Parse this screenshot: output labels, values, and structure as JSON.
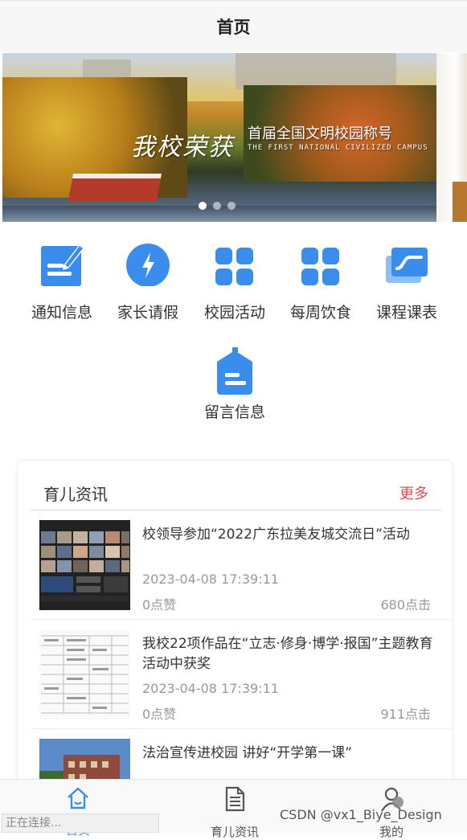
{
  "header": {
    "title": "首页"
  },
  "banner": {
    "slogan_main": "我校荣获",
    "slogan_sub": "首届全国文明校园称号",
    "slogan_en": "THE FIRST NATIONAL CIVILIZED CAMPUS",
    "active_dot": 0,
    "dots_count": 3
  },
  "menu": [
    {
      "label": "通知信息",
      "icon": "edit-note-icon",
      "color": "#3b8ded"
    },
    {
      "label": "家长请假",
      "icon": "lightning-icon",
      "color": "#3b8ded"
    },
    {
      "label": "校园活动",
      "icon": "grid-icon",
      "color": "#3b8ded"
    },
    {
      "label": "每周饮食",
      "icon": "grid-icon",
      "color": "#3b8ded"
    },
    {
      "label": "课程课表",
      "icon": "chart-card-icon",
      "color": "#3b8ded"
    },
    {
      "label": "留言信息",
      "icon": "message-tag-icon",
      "color": "#3b8ded"
    }
  ],
  "news": {
    "title": "育儿资讯",
    "more": "更多",
    "more_color": "#e2484f",
    "items": [
      {
        "title": "校领导参加“2022广东拉美友城交流日”活动",
        "date": "2023-04-08 17:39:11",
        "likes": "0点赞",
        "clicks": "680点击"
      },
      {
        "title": "我校22项作品在“立志·修身·博学·报国”主题教育活动中获奖",
        "date": "2023-04-08 17:39:11",
        "likes": "0点赞",
        "clicks": "911点击"
      },
      {
        "title": "法治宣传进校园 讲好“开学第一课”",
        "date": "",
        "likes": "",
        "clicks": ""
      }
    ]
  },
  "tabbar": {
    "tabs": [
      {
        "label": "首页",
        "icon": "home-icon",
        "active": true
      },
      {
        "label": "育儿资讯",
        "icon": "document-icon",
        "active": false
      },
      {
        "label": "我的",
        "icon": "user-icon",
        "active": false
      }
    ],
    "active_color": "#3b8ded"
  },
  "status": {
    "text": "正在连接..."
  },
  "watermark": {
    "text": "CSDN @vx1_Biye_Design"
  }
}
